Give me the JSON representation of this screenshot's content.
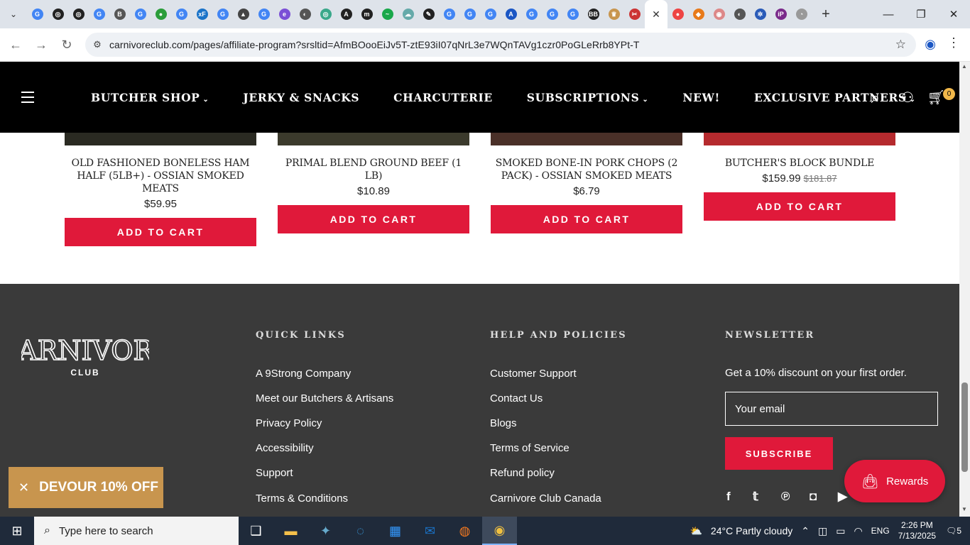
{
  "browser": {
    "tabs": [
      {
        "icon": "G",
        "color": "#4285f4"
      },
      {
        "icon": "◎",
        "color": "#222"
      },
      {
        "icon": "◎",
        "color": "#222"
      },
      {
        "icon": "G",
        "color": "#4285f4"
      },
      {
        "icon": "B",
        "color": "#555"
      },
      {
        "icon": "G",
        "color": "#4285f4"
      },
      {
        "icon": "●",
        "color": "#2a9d3a"
      },
      {
        "icon": "G",
        "color": "#4285f4"
      },
      {
        "icon": "xF",
        "color": "#1a73c8"
      },
      {
        "icon": "G",
        "color": "#4285f4"
      },
      {
        "icon": "▲",
        "color": "#444"
      },
      {
        "icon": "G",
        "color": "#4285f4"
      },
      {
        "icon": "e",
        "color": "#7b4fd6"
      },
      {
        "icon": "◐",
        "color": "#555"
      },
      {
        "icon": "◎",
        "color": "#3aa88a"
      },
      {
        "icon": "A",
        "color": "#222"
      },
      {
        "icon": "m",
        "color": "#222"
      },
      {
        "icon": "~",
        "color": "#19a84a"
      },
      {
        "icon": "☁",
        "color": "#6aa"
      },
      {
        "icon": "✎",
        "color": "#222"
      },
      {
        "icon": "G",
        "color": "#4285f4"
      },
      {
        "icon": "G",
        "color": "#4285f4"
      },
      {
        "icon": "G",
        "color": "#4285f4"
      },
      {
        "icon": "A",
        "color": "#1a56c4"
      },
      {
        "icon": "G",
        "color": "#4285f4"
      },
      {
        "icon": "G",
        "color": "#4285f4"
      },
      {
        "icon": "G",
        "color": "#4285f4"
      },
      {
        "icon": "BB",
        "color": "#222"
      },
      {
        "icon": "♛",
        "color": "#c8954e"
      },
      {
        "icon": "✂",
        "color": "#c33"
      }
    ],
    "tabs_after": [
      {
        "icon": "●",
        "color": "#e44"
      },
      {
        "icon": "◆",
        "color": "#e87a1a"
      },
      {
        "icon": "◉",
        "color": "#d88"
      },
      {
        "icon": "◐",
        "color": "#555"
      },
      {
        "icon": "✲",
        "color": "#2a5bb8"
      },
      {
        "icon": "iP",
        "color": "#7a2a8a"
      },
      {
        "icon": "◔",
        "color": "#999"
      }
    ],
    "active_tab_close": "✕",
    "new_tab": "+",
    "url": "carnivoreclub.com/pages/affiliate-program?srsltid=AfmBOooEiJv5T-ztE93iI07qNrL3e7WQnTAVg1czr0PoGLeRrb8YPt-T"
  },
  "header": {
    "nav": [
      {
        "label": "BUTCHER SHOP",
        "dropdown": true
      },
      {
        "label": "JERKY & SNACKS",
        "dropdown": false
      },
      {
        "label": "CHARCUTERIE",
        "dropdown": false
      },
      {
        "label": "SUBSCRIPTIONS",
        "dropdown": true
      },
      {
        "label": "NEW!",
        "dropdown": false
      },
      {
        "label": "EXCLUSIVE PARTNERS",
        "dropdown": true
      }
    ],
    "cart_count": "0"
  },
  "products": [
    {
      "title": "OLD FASHIONED BONELESS HAM HALF (5LB+) - OSSIAN SMOKED MEATS",
      "price": "$59.95",
      "old_price": "",
      "button": "ADD TO CART"
    },
    {
      "title": "PRIMAL BLEND GROUND BEEF (1 LB)",
      "price": "$10.89",
      "old_price": "",
      "button": "ADD TO CART"
    },
    {
      "title": "SMOKED BONE-IN PORK CHOPS (2 PACK) - OSSIAN SMOKED MEATS",
      "price": "$6.79",
      "old_price": "",
      "button": "ADD TO CART"
    },
    {
      "title": "BUTCHER'S BLOCK BUNDLE",
      "price": "$159.99",
      "old_price": "$181.87",
      "button": "ADD TO CART"
    }
  ],
  "footer": {
    "logo_top": "CARNIVORE",
    "logo_bottom": "CLUB",
    "quick_links_title": "QUICK LINKS",
    "quick_links": [
      "A 9Strong Company",
      "Meet our Butchers & Artisans",
      "Privacy Policy",
      "Accessibility",
      "Support",
      "Terms & Conditions"
    ],
    "policies_title": "HELP AND POLICIES",
    "policies": [
      "Customer Support",
      "Contact Us",
      "Blogs",
      "Terms of Service",
      "Refund policy",
      "Carnivore Club Canada"
    ],
    "newsletter_title": "NEWSLETTER",
    "newsletter_text": "Get a 10% discount on your first order.",
    "email_placeholder": "Your email",
    "subscribe": "SUBSCRIBE"
  },
  "popups": {
    "rewards": "Rewards",
    "devour": "DEVOUR 10% OFF"
  },
  "taskbar": {
    "search_placeholder": "Type here to search",
    "weather": "24°C  Partly cloudy",
    "language": "ENG",
    "time": "2:26 PM",
    "date": "7/13/2025",
    "notifications": "5"
  },
  "colors": {
    "brand_red": "#e0193a",
    "footer_bg": "#3a3a3a",
    "promo_gold": "#c8954e"
  }
}
